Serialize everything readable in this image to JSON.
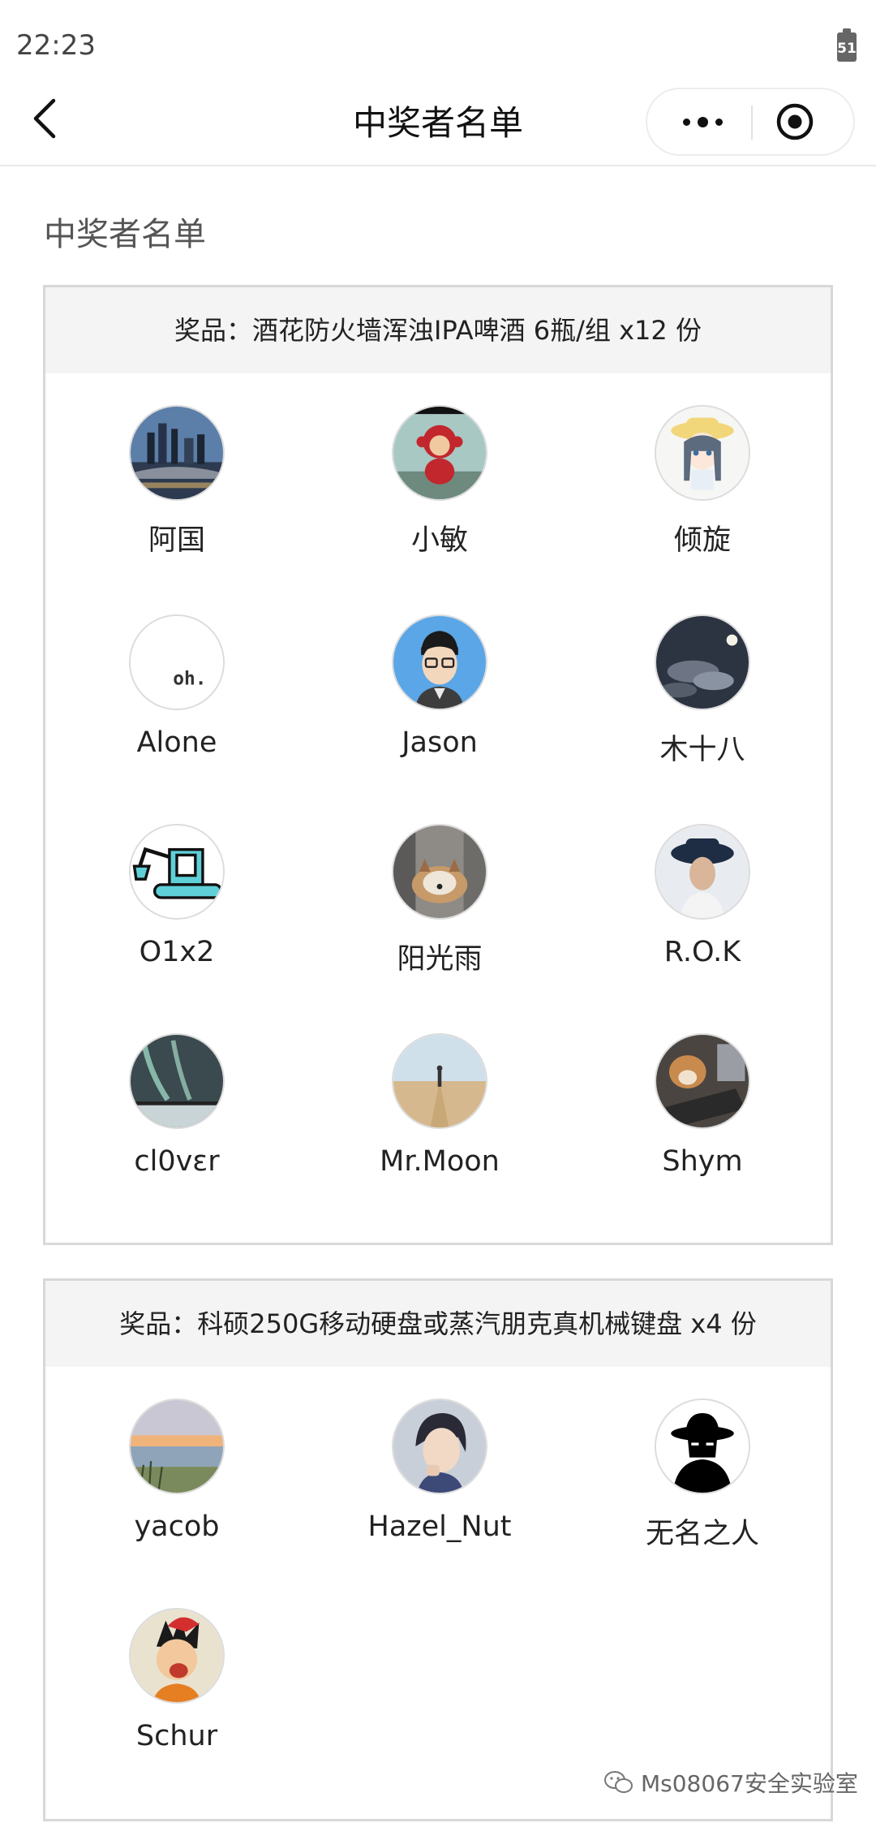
{
  "status_bar": {
    "time": "22:23",
    "battery": "51"
  },
  "nav": {
    "title": "中奖者名单"
  },
  "section_heading": "中奖者名单",
  "prizes": [
    {
      "label": "奖品：酒花防火墙浑浊IPA啤酒 6瓶/组 x12 份",
      "winners": [
        "阿国",
        "小敏",
        "倾旋",
        "Alone",
        "Jason",
        "木十八",
        "O1x2",
        "阳光雨",
        "R.O.K",
        "cl0vɛr",
        "Mr.Moon",
        "Shym"
      ]
    },
    {
      "label": "奖品：科硕250G移动硬盘或蒸汽朋克真机械键盘 x4 份",
      "winners": [
        "yacob",
        "Hazel_Nut",
        "无名之人",
        "Schur"
      ]
    }
  ],
  "avatar_text": "oh.",
  "watermark": "Ms08067安全实验室"
}
